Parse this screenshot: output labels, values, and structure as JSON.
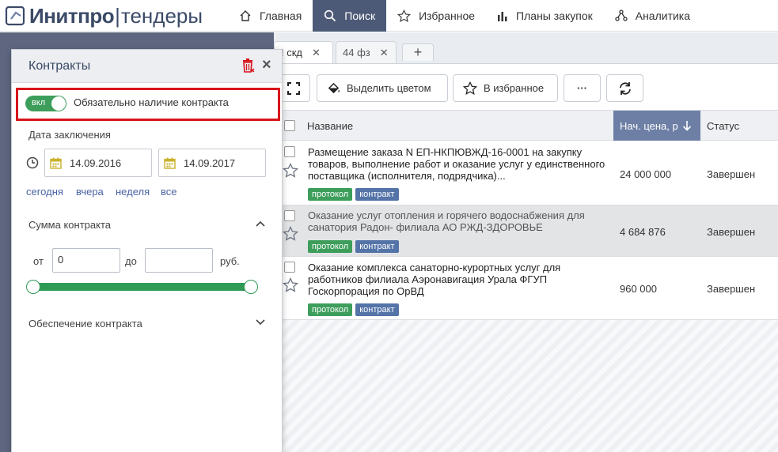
{
  "brand": {
    "name_bold": "Инитпро",
    "sep": "|",
    "name_light": "тендеры"
  },
  "nav": [
    {
      "label": "Главная",
      "icon": "home-icon"
    },
    {
      "label": "Поиск",
      "icon": "search-icon",
      "active": true
    },
    {
      "label": "Избранное",
      "icon": "star-icon"
    },
    {
      "label": "Планы закупок",
      "icon": "chart-bars-icon"
    },
    {
      "label": "Аналитика",
      "icon": "network-icon"
    }
  ],
  "tabs": [
    {
      "label": "! скд",
      "close": "✕"
    },
    {
      "label": "44 фз",
      "close": "✕"
    },
    {
      "label": "+"
    }
  ],
  "toolbar": {
    "highlight_label": "Выделить цветом",
    "favorite_label": "В избранное",
    "more_label": "···"
  },
  "table": {
    "columns": {
      "name": "Название",
      "price": "Нач. цена, р",
      "status": "Статус"
    },
    "rows": [
      {
        "title": "Размещение заказа N ЕП-НКПЮВЖД-16-0001 на закупку товаров, выполнение работ и оказание услуг у единственного поставщика (исполнителя, подрядчика)...",
        "price": "24 000 000",
        "status": "Завершен",
        "tags": [
          "протокол",
          "контракт"
        ]
      },
      {
        "title": "Оказание услуг отопления и горячего водоснабжения для санатория Радон- филиала АО РЖД-ЗДОРОВЬЕ",
        "price": "4 684 876",
        "status": "Завершен",
        "tags": [
          "протокол",
          "контракт"
        ]
      },
      {
        "title": "Оказание комплекса санаторно-курортных услуг для работников филиала Аэронавигация Урала ФГУП Госкорпорация по ОрВД",
        "price": "960 000",
        "status": "Завершен",
        "tags": [
          "протокол",
          "контракт"
        ]
      }
    ]
  },
  "panel": {
    "title": "Контракты",
    "toggle_state": "вкл",
    "toggle_text": "Обязательно наличие контракта",
    "date_label": "Дата заключения",
    "date_from": "14.09.2016",
    "date_to": "14.09.2017",
    "quick": [
      "сегодня",
      "вчера",
      "неделя",
      "все"
    ],
    "sum_label": "Сумма контракта",
    "from_label": "от",
    "from_value": "0",
    "to_label": "до",
    "to_value": "",
    "currency": "руб.",
    "security_label": "Обеспечение контракта"
  },
  "colors": {
    "accent": "#4d5a77",
    "green": "#3d9e5b",
    "tag_blue": "#5474a8",
    "highlight": "#d8141b",
    "sorted_col": "#6d7fa5"
  }
}
